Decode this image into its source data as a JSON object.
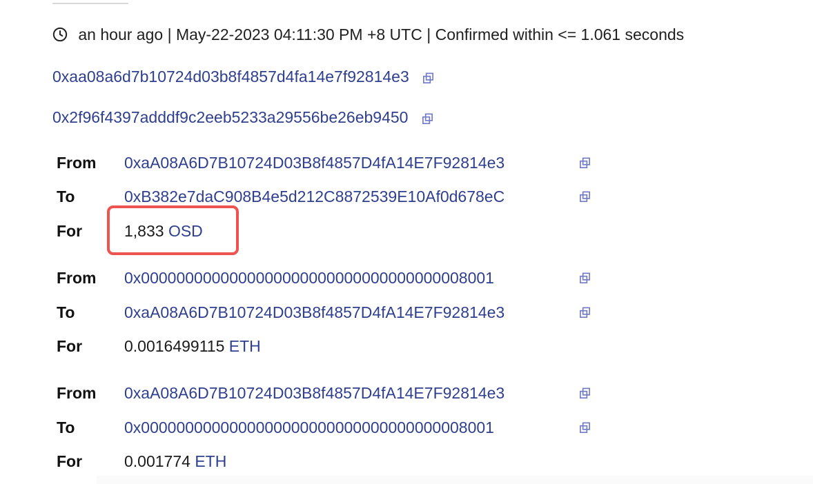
{
  "header": {
    "relative_time": "an hour ago",
    "separator_1": "|",
    "timestamp": "May-22-2023 04:11:30 PM +8 UTC",
    "separator_2": "|",
    "confirmation": "Confirmed within <= 1.061 seconds",
    "clock_icon": "clock-icon"
  },
  "addresses": {
    "from_address": "0xaa08a6d7b10724d03b8f4857d4fa14e7f92814e3",
    "to_address": "0x2f96f4397adddf9c2eeb5233a29556be26eb9450",
    "copy_icon": "copy-icon"
  },
  "transfers": [
    {
      "from_label": "From",
      "from_value": "0xaA08A6D7B10724D03B8f4857D4fA14E7F92814e3",
      "to_label": "To",
      "to_value": "0xB382e7daC908B4e5d212C8872539E10Af0d678eC",
      "for_label": "For",
      "amount": "1,833",
      "token": "OSD"
    },
    {
      "from_label": "From",
      "from_value": "0x0000000000000000000000000000000000008001",
      "to_label": "To",
      "to_value": "0xaA08A6D7B10724D03B8f4857D4fA14E7F92814e3",
      "for_label": "For",
      "amount": "0.0016499115",
      "token": "ETH"
    },
    {
      "from_label": "From",
      "from_value": "0xaA08A6D7B10724D03B8f4857D4fA14E7F92814e3",
      "to_label": "To",
      "to_value": "0x0000000000000000000000000000000000008001",
      "for_label": "For",
      "amount": "0.001774",
      "token": "ETH"
    }
  ],
  "colors": {
    "link": "#2f3f8f",
    "copy_icon": "#6f78c8",
    "highlight": "#ef5350"
  }
}
